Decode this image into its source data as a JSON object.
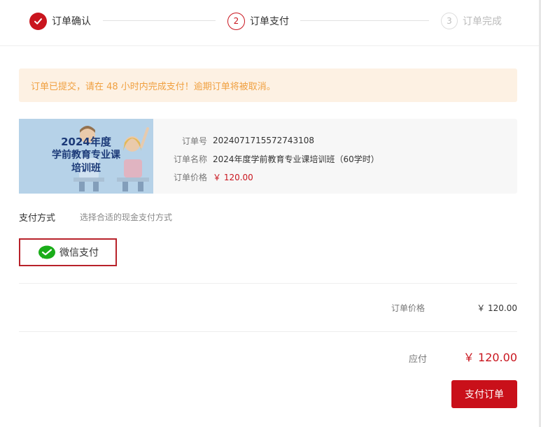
{
  "steps": [
    {
      "number": "",
      "label": "订单确认",
      "state": "done"
    },
    {
      "number": "2",
      "label": "订单支付",
      "state": "active"
    },
    {
      "number": "3",
      "label": "订单完成",
      "state": "pending"
    }
  ],
  "notice": "订单已提交，请在 48 小时内完成支付！逾期订单将被取消。",
  "order": {
    "cover_title_line1": "2024年度",
    "cover_title_line2": "学前教育专业课",
    "cover_title_line3": "培训班",
    "number_key": "订单号",
    "number_value": "2024071715572743108",
    "name_key": "订单名称",
    "name_value": "2024年度学前教育专业课培训班（60学时）",
    "price_key": "订单价格",
    "price_value": "￥ 120.00"
  },
  "payment": {
    "title": "支付方式",
    "hint": "选择合适的现金支付方式",
    "option_label": "微信支付",
    "option_icon": "wechat-pay-icon"
  },
  "summary": {
    "price_label": "订单价格",
    "price_value": "￥ 120.00",
    "due_label": "应付",
    "due_value": "￥ 120.00"
  },
  "submit_label": "支付订单",
  "colors": {
    "accent": "#c9151e",
    "notice_bg": "#fdf1e3",
    "notice_text": "#f0a040",
    "wechat_green": "#1aad19"
  }
}
